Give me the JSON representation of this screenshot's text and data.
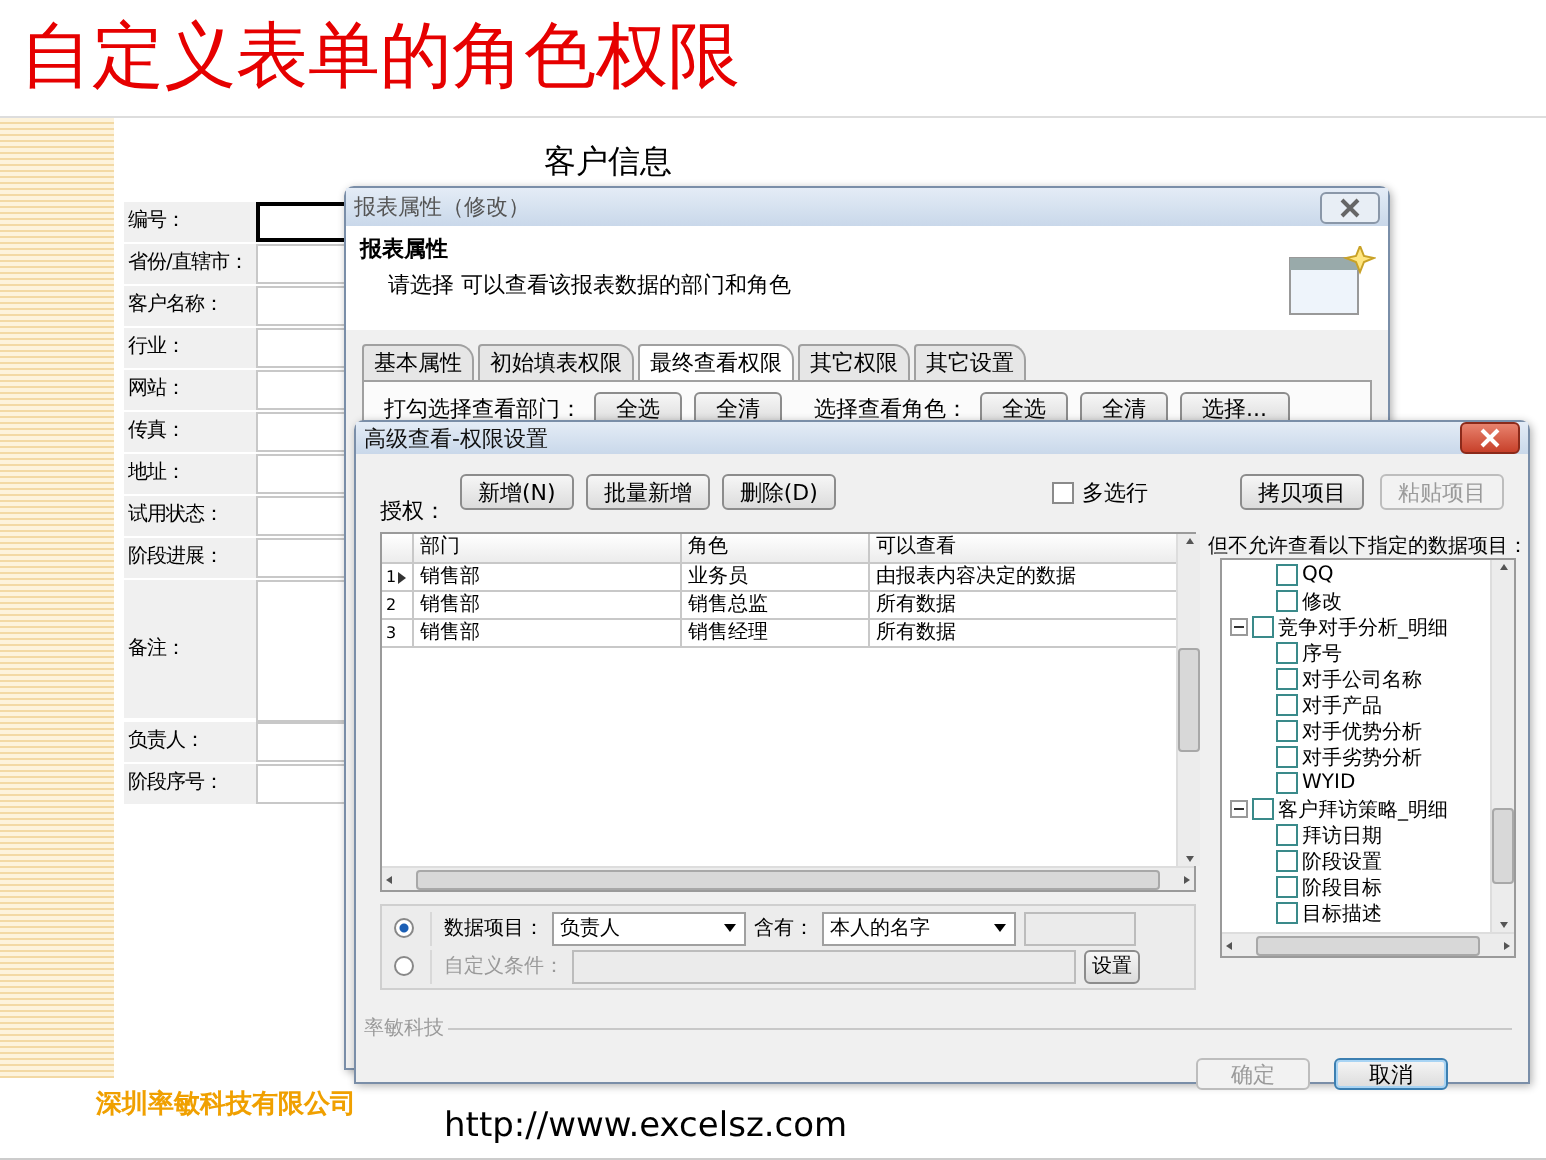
{
  "slide": {
    "title": "自定义表单的角色权限",
    "company": "深圳率敏科技有限公司",
    "url": "http://www.excelsz.com"
  },
  "form": {
    "title": "客户信息",
    "fields": [
      {
        "label": "编号：",
        "kind": "line",
        "focused": true
      },
      {
        "label": "省份/直辖市：",
        "kind": "line",
        "focused": false
      },
      {
        "label": "客户名称：",
        "kind": "line",
        "focused": false
      },
      {
        "label": "行业：",
        "kind": "line",
        "focused": false
      },
      {
        "label": "网站：",
        "kind": "line",
        "focused": false
      },
      {
        "label": "传真：",
        "kind": "line",
        "focused": false
      },
      {
        "label": "地址：",
        "kind": "line",
        "focused": false
      },
      {
        "label": "试用状态：",
        "kind": "line",
        "focused": false
      },
      {
        "label": "阶段进展：",
        "kind": "line",
        "focused": false
      },
      {
        "label": "备注：",
        "kind": "multiline",
        "focused": false
      },
      {
        "label": "负责人：",
        "kind": "line",
        "focused": false
      },
      {
        "label": "阶段序号：",
        "kind": "line",
        "focused": false
      }
    ]
  },
  "report_dialog": {
    "title": "报表属性（修改）",
    "heading": "报表属性",
    "description": "请选择  可以查看该报表数据的部门和角色",
    "tabs": [
      {
        "label": "基本属性",
        "selected": false
      },
      {
        "label": "初始填表权限",
        "selected": false
      },
      {
        "label": "最终查看权限",
        "selected": true
      },
      {
        "label": "其它权限",
        "selected": false
      },
      {
        "label": "其它设置",
        "selected": false
      }
    ],
    "dept_label": "打勾选择查看部门：",
    "dept_buttons": [
      "全选",
      "全清"
    ],
    "role_label": "选择查看角色：",
    "role_buttons": [
      "全选",
      "全清",
      "选择..."
    ]
  },
  "advanced_dialog": {
    "title": "高级查看-权限设置",
    "auth_label": "授权：",
    "buttons": [
      "新增(N)",
      "批量新增",
      "删除(D)"
    ],
    "multi_select": {
      "label": "多选行",
      "checked": false
    },
    "copy_button": {
      "label": "拷贝项目",
      "disabled": false
    },
    "paste_button": {
      "label": "粘贴项目",
      "disabled": true
    },
    "table": {
      "columns": [
        "部门",
        "角色",
        "可以查看"
      ],
      "rows": [
        {
          "number": "1",
          "current": true,
          "cells": [
            "销售部",
            "业务员",
            "由报表内容决定的数据"
          ]
        },
        {
          "number": "2",
          "current": false,
          "cells": [
            "销售部",
            "销售总监",
            "所有数据"
          ]
        },
        {
          "number": "3",
          "current": false,
          "cells": [
            "销售部",
            "销售经理",
            "所有数据"
          ]
        }
      ]
    },
    "restriction_label": "但不允许查看以下指定的数据项目：",
    "tree": [
      {
        "children": [
          {
            "label": "QQ",
            "checked": false
          },
          {
            "label": "修改",
            "checked": false
          }
        ]
      },
      {
        "label": "竞争对手分析_明细",
        "checked": false,
        "expanded": true,
        "children": [
          {
            "label": "序号",
            "checked": false
          },
          {
            "label": "对手公司名称",
            "checked": false
          },
          {
            "label": "对手产品",
            "checked": false
          },
          {
            "label": "对手优势分析",
            "checked": false
          },
          {
            "label": "对手劣势分析",
            "checked": false
          },
          {
            "label": "WYID",
            "checked": false
          }
        ]
      },
      {
        "label": "客户拜访策略_明细",
        "checked": false,
        "expanded": true,
        "children": [
          {
            "label": "拜访日期",
            "checked": false
          },
          {
            "label": "阶段设置",
            "checked": false
          },
          {
            "label": "阶段目标",
            "checked": false
          },
          {
            "label": "目标描述",
            "checked": false
          }
        ]
      }
    ],
    "conditions": [
      {
        "kind": "item",
        "selected": true,
        "label": "数据项目：",
        "item": "负责人",
        "match_label": "含有：",
        "match": "本人的名字"
      },
      {
        "kind": "custom",
        "selected": false,
        "label": "自定义条件：",
        "button": "设置"
      }
    ],
    "footer_label": "率敏科技",
    "ok_button": {
      "label": "确定",
      "disabled": true
    },
    "cancel_button": {
      "label": "取消",
      "disabled": false
    }
  }
}
